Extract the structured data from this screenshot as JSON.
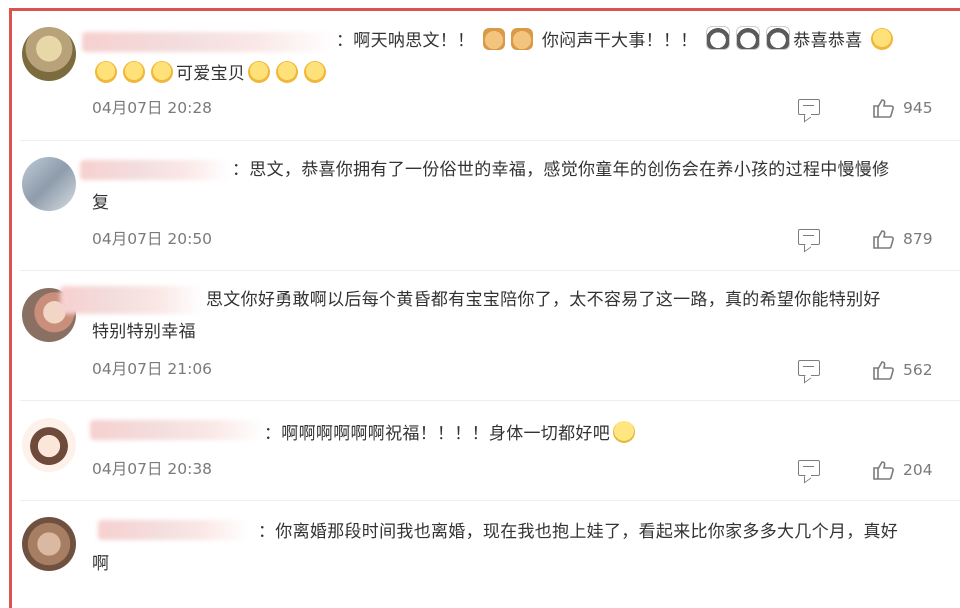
{
  "comments": [
    {
      "text_lines": [
        "：啊天呐思文！！",
        "可爱宝贝"
      ],
      "text_mid": "你闷声干大事！！！",
      "text_end": "恭喜恭喜",
      "timestamp": "04月07日 20:28",
      "likes": "945",
      "avatar": "avatar-cartoon"
    },
    {
      "text_lines": [
        "：思文，恭喜你拥有了一份俗世的幸福，感觉你童年的创伤会在养小孩的过程中慢慢修",
        "复"
      ],
      "timestamp": "04月07日 20:50",
      "likes": "879",
      "avatar": "avatar-photo"
    },
    {
      "text_lines": [
        "思文你好勇敢啊以后每个黄昏都有宝宝陪你了，太不容易了这一路，真的希望你能特别好",
        "特别特别幸福"
      ],
      "timestamp": "04月07日 21:06",
      "likes": "562",
      "avatar": "avatar-photo"
    },
    {
      "text_lines": [
        "：啊啊啊啊啊啊祝福！！！！身体一切都好吧"
      ],
      "timestamp": "04月07日 20:38",
      "likes": "204",
      "avatar": "avatar-girl"
    },
    {
      "text_lines": [
        "：你离婚那段时间我也离婚，现在我也抱上娃了，看起来比你家多多大几个月，真好",
        "啊"
      ],
      "avatar": "avatar-photo"
    }
  ],
  "icons": {
    "reply": "comment-icon",
    "like": "thumbs-up-icon"
  },
  "colors": {
    "frame": "#d9534f",
    "meta_text": "#7a7a7a",
    "body_text": "#333333"
  }
}
